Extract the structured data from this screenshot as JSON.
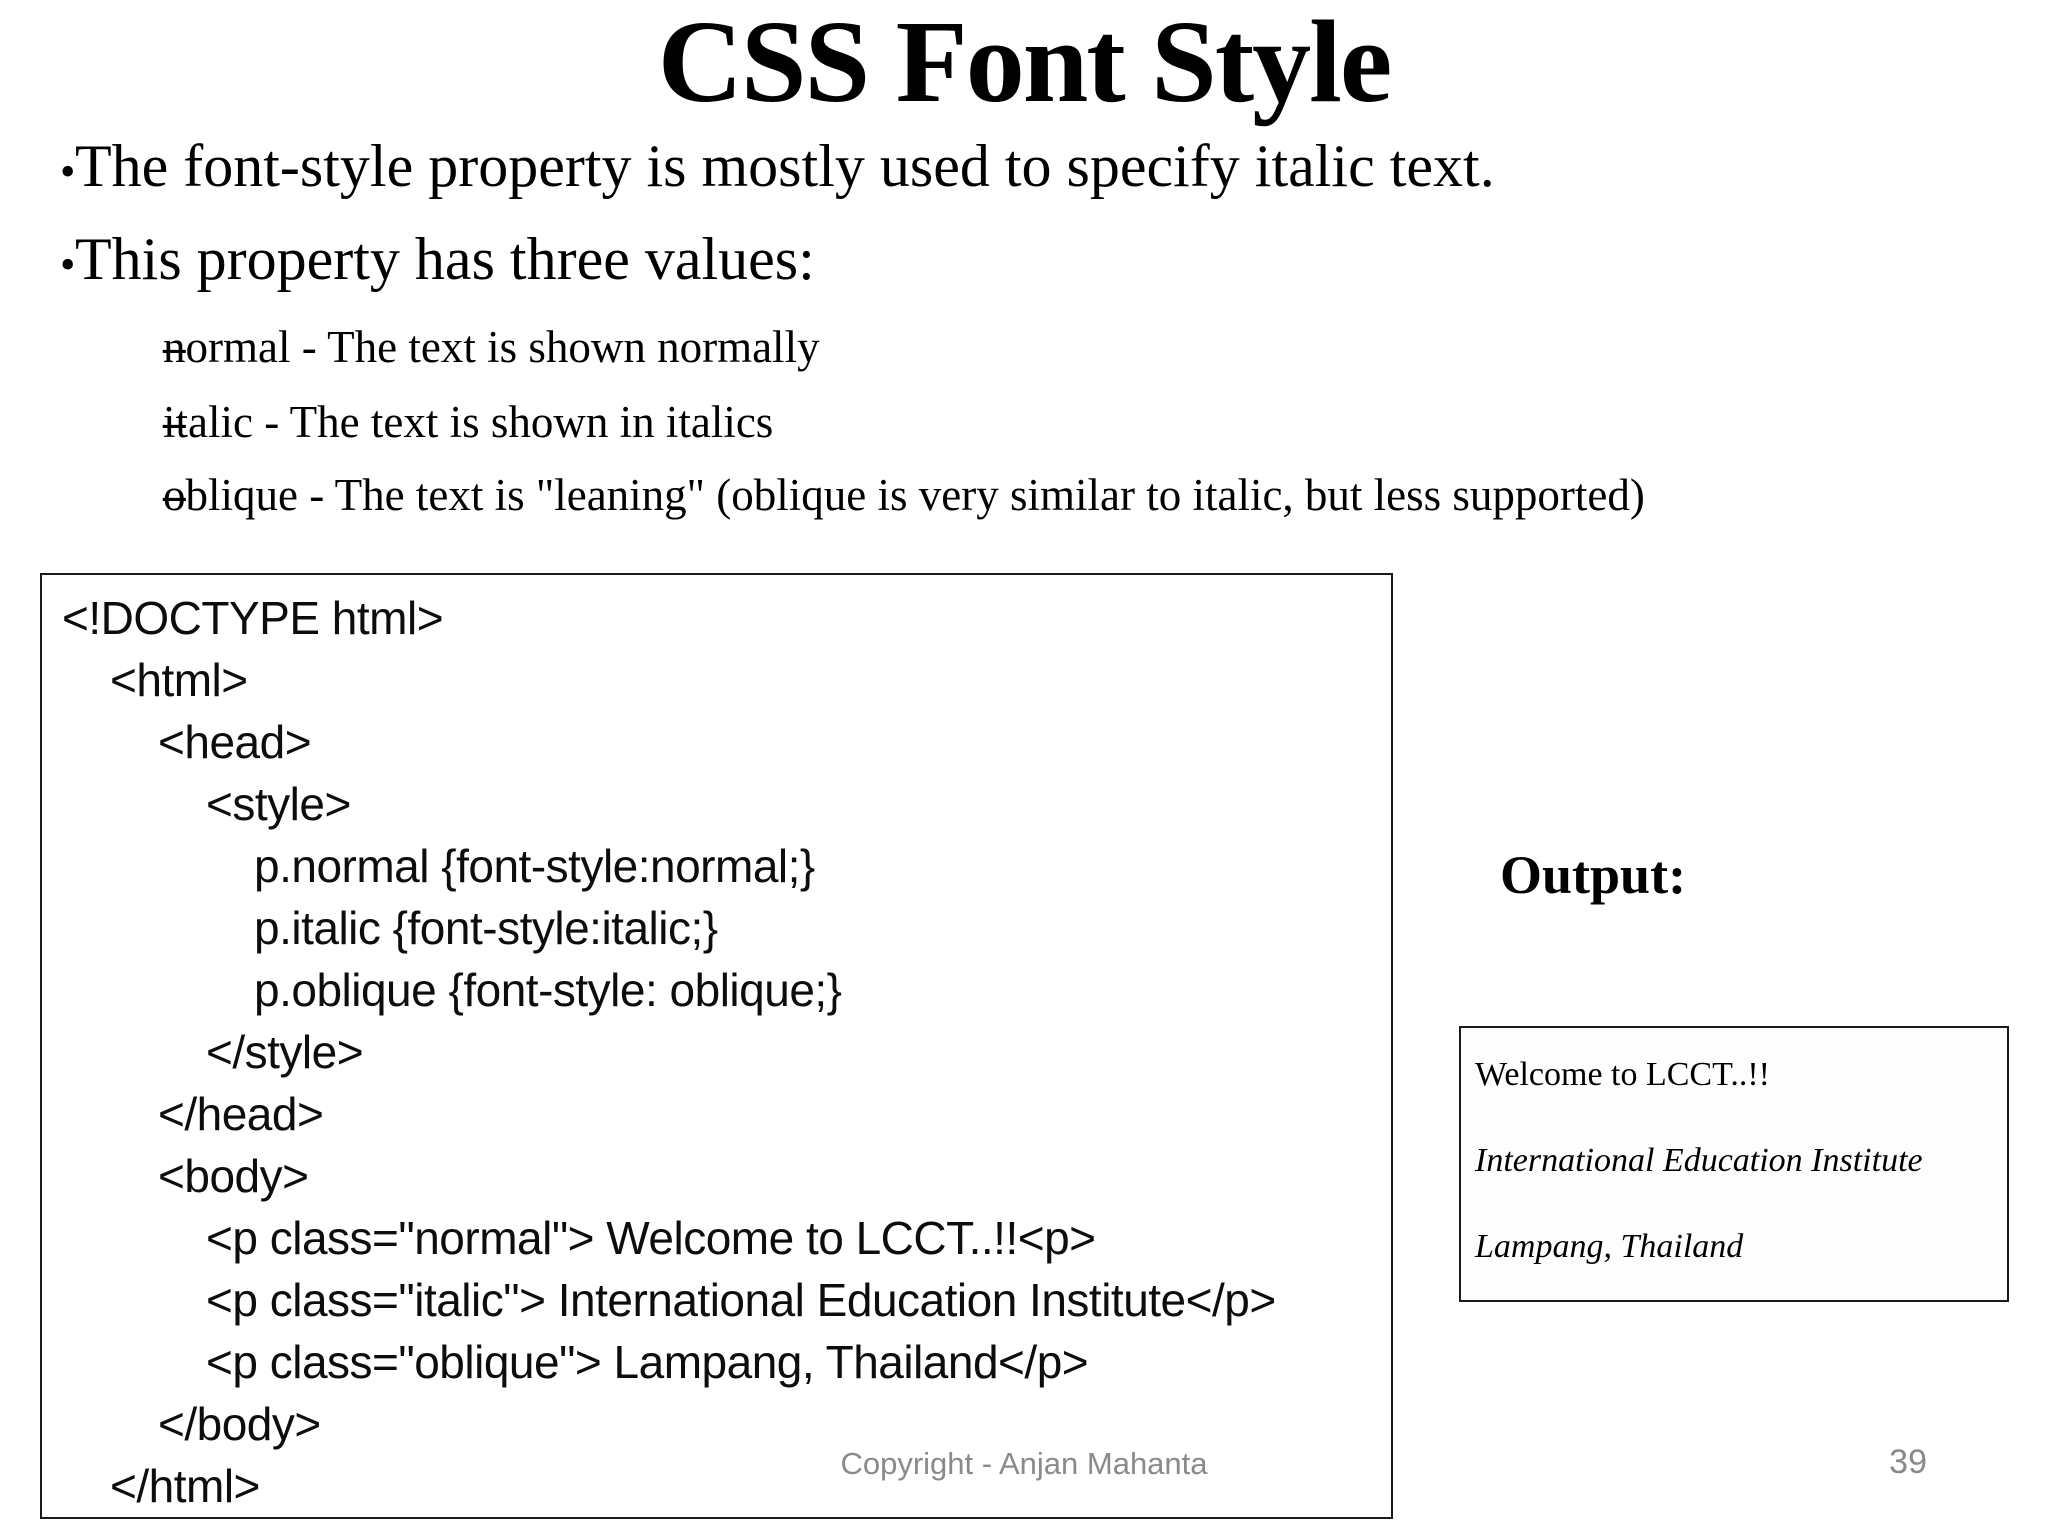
{
  "slide": {
    "title": "CSS Font Style",
    "bullets": [
      {
        "marker": "•",
        "text": "The font-style property is mostly used to specify italic text."
      },
      {
        "marker": "•",
        "text": "This property has three values:"
      },
      {
        "marker": "–",
        "text": "normal - The text is shown normally"
      },
      {
        "marker": "–",
        "text": "italic - The text is shown in italics"
      },
      {
        "marker": "–",
        "text": "oblique - The text is \"leaning\" (oblique is very similar to italic, but less supported)"
      }
    ],
    "code_block": {
      "lines": [
        {
          "indent": 0,
          "text": "<!DOCTYPE html>"
        },
        {
          "indent": 1,
          "text": "<html>"
        },
        {
          "indent": 2,
          "text": "<head>"
        },
        {
          "indent": 3,
          "text": "<style>"
        },
        {
          "indent": 4,
          "text": "p.normal {font-style:normal;}"
        },
        {
          "indent": 4,
          "text": "p.italic {font-style:italic;}"
        },
        {
          "indent": 4,
          "text": "p.oblique {font-style: oblique;}"
        },
        {
          "indent": 3,
          "text": "</style>"
        },
        {
          "indent": 2,
          "text": "</head>"
        },
        {
          "indent": 2,
          "text": "<body>"
        },
        {
          "indent": 3,
          "text": "<p class=\"normal\"> Welcome to LCCT..!!<p>"
        },
        {
          "indent": 3,
          "text": "<p class=\"italic\"> International Education Institute</p>"
        },
        {
          "indent": 3,
          "text": "<p class=\"oblique\"> Lampang, Thailand</p>"
        },
        {
          "indent": 2,
          "text": "</body>"
        },
        {
          "indent": 1,
          "text": "</html>"
        }
      ]
    },
    "output_label": "Output:",
    "output_box": {
      "lines": [
        {
          "style": "normal",
          "text": "Welcome to LCCT..!!"
        },
        {
          "style": "italic",
          "text": "International Education Institute"
        },
        {
          "style": "oblique",
          "text": "Lampang, Thailand"
        }
      ]
    },
    "footer": {
      "copyright": "Copyright - Anjan Mahanta",
      "page_number": "39"
    },
    "colors": {
      "background": "#ffffff",
      "text": "#000000",
      "border": "#1a1a1a",
      "footer_gray": "#8a8a8a"
    }
  }
}
